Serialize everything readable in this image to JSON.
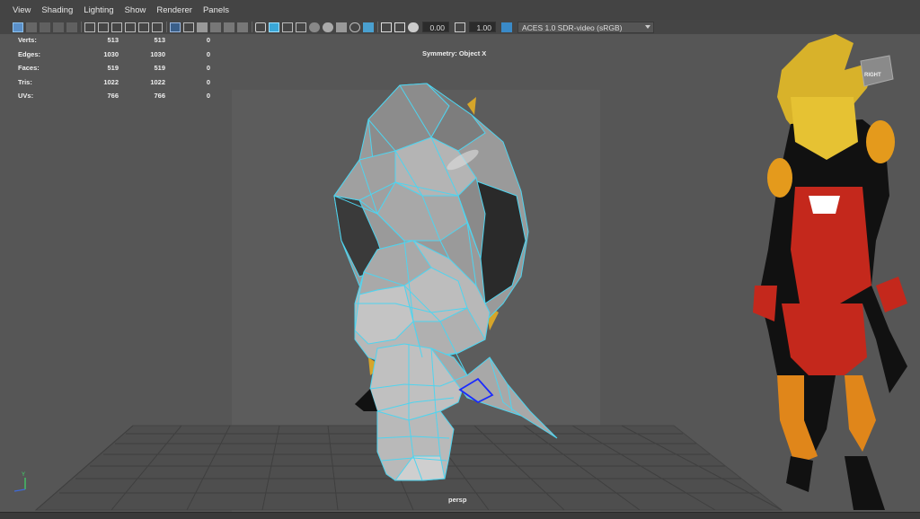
{
  "menu": [
    "View",
    "Shading",
    "Lighting",
    "Show",
    "Renderer",
    "Panels"
  ],
  "toolbar": {
    "exposure_value": "0.00",
    "gamma_value": "1.00",
    "color_space": "ACES 1.0 SDR-video (sRGB)"
  },
  "hud": {
    "rows": [
      {
        "label": "Verts:",
        "v1": "513",
        "v2": "513",
        "v3": "0"
      },
      {
        "label": "Edges:",
        "v1": "1030",
        "v2": "1030",
        "v3": "0"
      },
      {
        "label": "Faces:",
        "v1": "519",
        "v2": "519",
        "v3": "0"
      },
      {
        "label": "Tris:",
        "v1": "1022",
        "v2": "1022",
        "v3": "0"
      },
      {
        "label": "UVs:",
        "v1": "766",
        "v2": "766",
        "v3": "0"
      }
    ],
    "symmetry": "Symmetry: Object X",
    "camera": "persp"
  },
  "viewcube_label": "RIGHT",
  "colors": {
    "wire": "#4fd4ef",
    "selected_face": "#1a2aff",
    "menubar_bg": "#444444",
    "viewport_bg": "#565656"
  }
}
